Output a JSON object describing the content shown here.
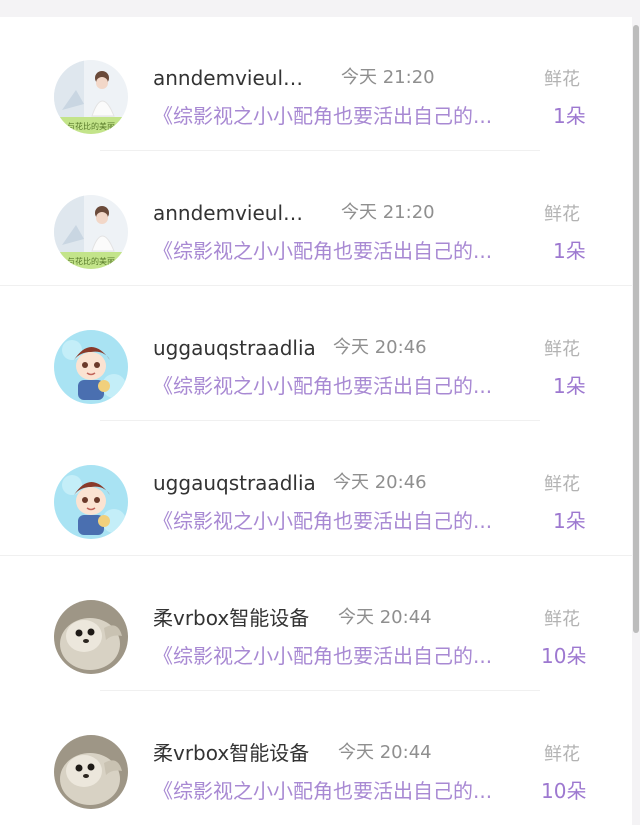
{
  "items": [
    {
      "name": "anndemvieule...",
      "time": "今天 21:20",
      "label": "鲜花",
      "title": "《综影视之小小配角也要活出自己的...",
      "count": "1朵",
      "avatar": "girl-avatar",
      "avatar_caption": "与花比的美丽"
    },
    {
      "name": "anndemvieule...",
      "time": "今天 21:20",
      "label": "鲜花",
      "title": "《综影视之小小配角也要活出自己的...",
      "count": "1朵",
      "avatar": "girl-avatar",
      "avatar_caption": "与花比的美丽"
    },
    {
      "name": "uggauqstraadlia",
      "time": "今天 20:46",
      "label": "鲜花",
      "title": "《综影视之小小配角也要活出自己的...",
      "count": "1朵",
      "avatar": "cartoon-boy-avatar"
    },
    {
      "name": "uggauqstraadlia",
      "time": "今天 20:46",
      "label": "鲜花",
      "title": "《综影视之小小配角也要活出自己的...",
      "count": "1朵",
      "avatar": "cartoon-boy-avatar"
    },
    {
      "name": "柔vrbox智能设备",
      "time": "今天 20:44",
      "label": "鲜花",
      "title": "《综影视之小小配角也要活出自己的...",
      "count": "10朵",
      "avatar": "seal-avatar"
    },
    {
      "name": "柔vrbox智能设备",
      "time": "今天 20:44",
      "label": "鲜花",
      "title": "《综影视之小小配角也要活出自己的...",
      "count": "10朵",
      "avatar": "seal-avatar"
    }
  ],
  "colors": {
    "accent": "#a889d3",
    "name_text": "#333333",
    "muted_text": "#8f8f8f",
    "label_text": "#b3b3b3"
  }
}
